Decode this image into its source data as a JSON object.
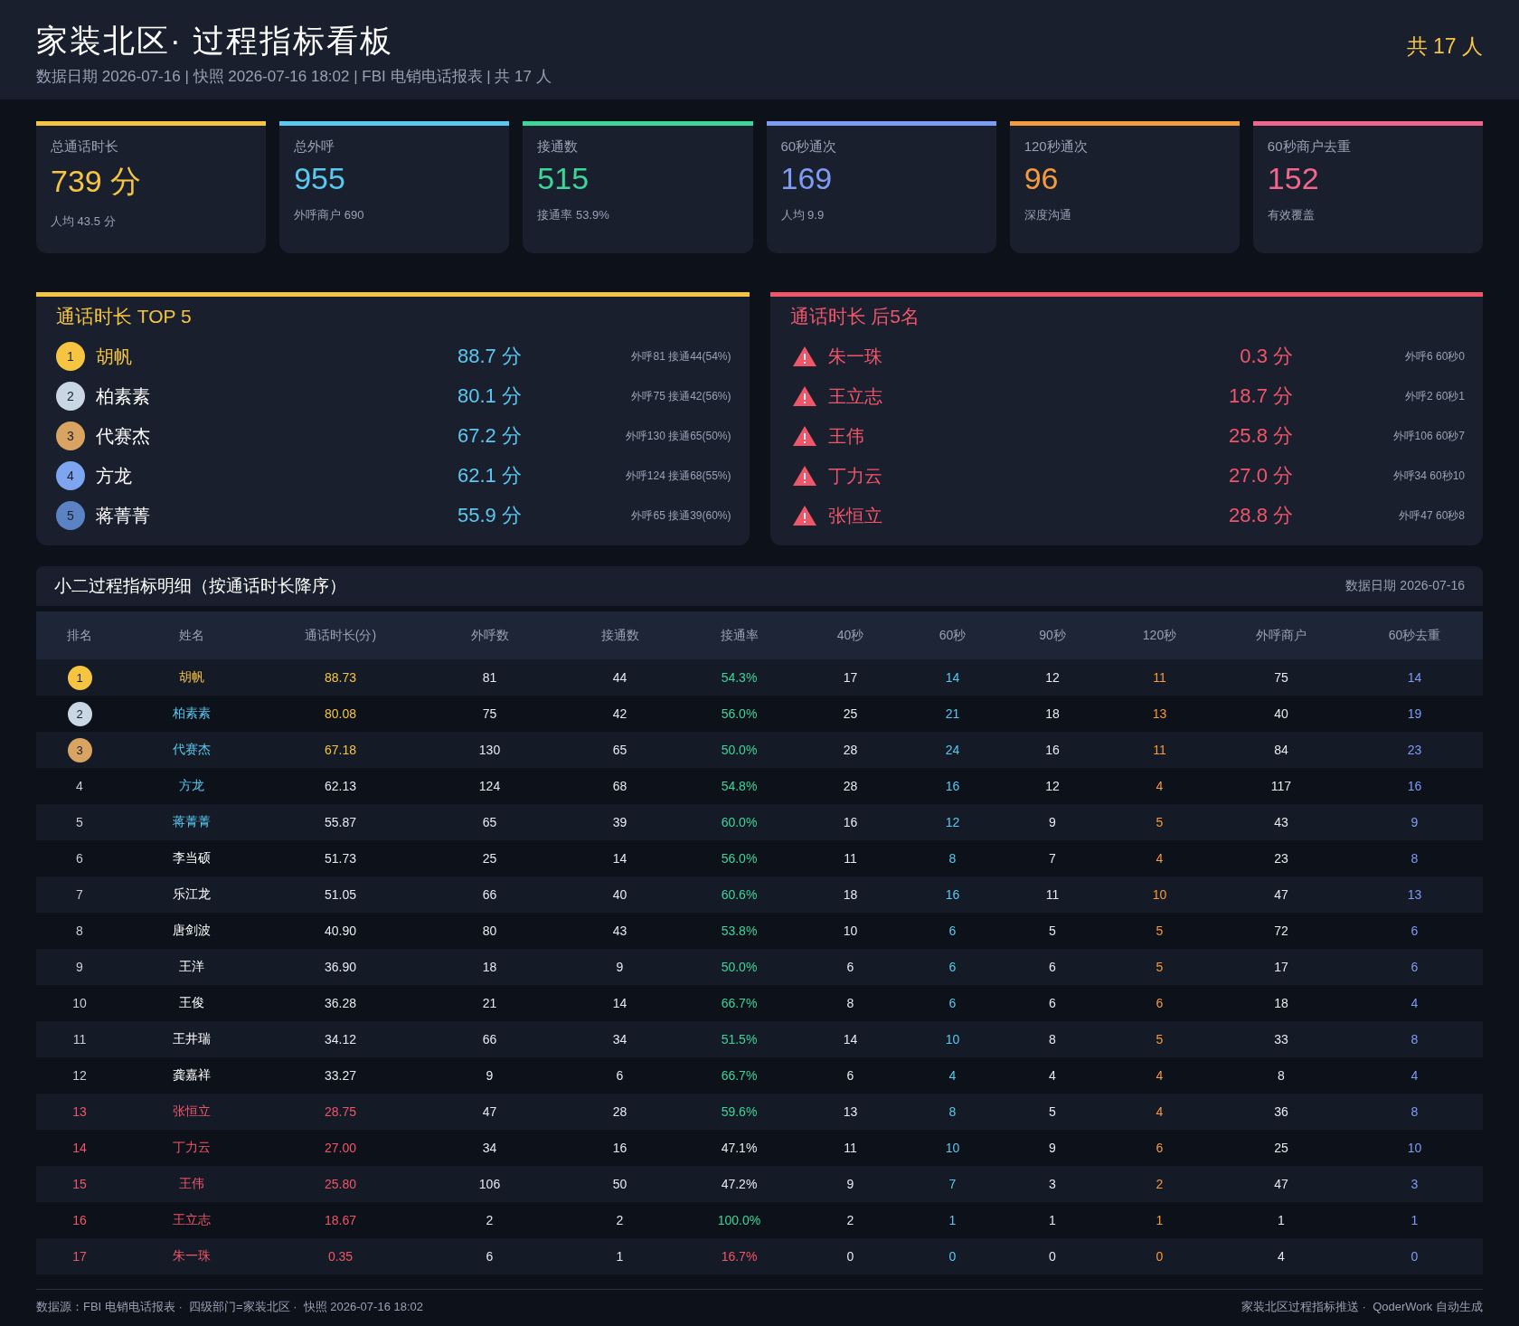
{
  "header": {
    "title": "家装北区· 过程指标看板",
    "subtitle": "数据日期 2026-07-16 | 快照 2026-07-16 18:02 | FBI 电销电话报表 | 共 17 人",
    "headcount": "共 17 人"
  },
  "kpis": [
    {
      "label": "总通话时长",
      "value": "739 分",
      "note": "人均 43.5 分",
      "color": "#f5c542"
    },
    {
      "label": "总外呼",
      "value": "955",
      "note": "外呼商户 690",
      "color": "#5bc8f0"
    },
    {
      "label": "接通数",
      "value": "515",
      "note": "接通率 53.9%",
      "color": "#3ed598"
    },
    {
      "label": "60秒通次",
      "value": "169",
      "note": "人均 9.9",
      "color": "#7f9cf5"
    },
    {
      "label": "120秒通次",
      "value": "96",
      "note": "深度沟通",
      "color": "#f59a3e"
    },
    {
      "label": "60秒商户去重",
      "value": "152",
      "note": "有效覆盖",
      "color": "#f0668c"
    }
  ],
  "top_panel": {
    "title": "通话时长 TOP 5",
    "items": [
      {
        "rank": "1",
        "name": "胡帆",
        "value": "88.7 分",
        "detail": "外呼81 接通44(54%)",
        "color": "#f5c542",
        "highlight": true
      },
      {
        "rank": "2",
        "name": "柏素素",
        "value": "80.1 分",
        "detail": "外呼75 接通42(56%)",
        "color": "#c9d6e3",
        "highlight": false
      },
      {
        "rank": "3",
        "name": "代赛杰",
        "value": "67.2 分",
        "detail": "外呼130 接通65(50%)",
        "color": "#d9a362",
        "highlight": false
      },
      {
        "rank": "4",
        "name": "方龙",
        "value": "62.1 分",
        "detail": "外呼124 接通68(55%)",
        "color": "#7ea6f0",
        "highlight": false
      },
      {
        "rank": "5",
        "name": "蒋菁菁",
        "value": "55.9 分",
        "detail": "外呼65 接通39(60%)",
        "color": "#5b83c4",
        "highlight": false
      }
    ]
  },
  "bottom_panel": {
    "title": "通话时长 后5名",
    "items": [
      {
        "name": "朱一珠",
        "value": "0.3 分",
        "detail": "外呼6 60秒0"
      },
      {
        "name": "王立志",
        "value": "18.7 分",
        "detail": "外呼2 60秒1"
      },
      {
        "name": "王伟",
        "value": "25.8 分",
        "detail": "外呼106 60秒7"
      },
      {
        "name": "丁力云",
        "value": "27.0 分",
        "detail": "外呼34 60秒10"
      },
      {
        "name": "张恒立",
        "value": "28.8 分",
        "detail": "外呼47 60秒8"
      }
    ]
  },
  "table": {
    "title": "小二过程指标明细（按通话时长降序）",
    "date": "数据日期 2026-07-16",
    "columns": [
      "排名",
      "姓名",
      "通话时长(分)",
      "外呼数",
      "接通数",
      "接通率",
      "40秒",
      "60秒",
      "90秒",
      "120秒",
      "外呼商户",
      "60秒去重"
    ],
    "rows": [
      {
        "kind": "leader",
        "color": "#f5c542",
        "cells": [
          "1",
          "胡帆",
          "88.73",
          "81",
          "44",
          "54.3%",
          "17",
          "14",
          "12",
          "11",
          "75",
          "14"
        ],
        "rate_ok": true,
        "rate_alert": false
      },
      {
        "kind": "top",
        "color": "#c9d6e3",
        "cells": [
          "2",
          "柏素素",
          "80.08",
          "75",
          "42",
          "56.0%",
          "25",
          "21",
          "18",
          "13",
          "40",
          "19"
        ],
        "rate_ok": true,
        "rate_alert": false
      },
      {
        "kind": "top",
        "color": "#d9a362",
        "cells": [
          "3",
          "代赛杰",
          "67.18",
          "130",
          "65",
          "50.0%",
          "28",
          "24",
          "16",
          "11",
          "84",
          "23"
        ],
        "rate_ok": true,
        "rate_alert": false
      },
      {
        "kind": "top",
        "cells": [
          "4",
          "方龙",
          "62.13",
          "124",
          "68",
          "54.8%",
          "28",
          "16",
          "12",
          "4",
          "117",
          "16"
        ],
        "rate_ok": true,
        "rate_alert": false
      },
      {
        "kind": "top",
        "cells": [
          "5",
          "蒋菁菁",
          "55.87",
          "65",
          "39",
          "60.0%",
          "16",
          "12",
          "9",
          "5",
          "43",
          "9"
        ],
        "rate_ok": true,
        "rate_alert": false
      },
      {
        "kind": "normal",
        "cells": [
          "6",
          "李当硕",
          "51.73",
          "25",
          "14",
          "56.0%",
          "11",
          "8",
          "7",
          "4",
          "23",
          "8"
        ],
        "rate_ok": true,
        "rate_alert": false
      },
      {
        "kind": "normal",
        "cells": [
          "7",
          "乐江龙",
          "51.05",
          "66",
          "40",
          "60.6%",
          "18",
          "16",
          "11",
          "10",
          "47",
          "13"
        ],
        "rate_ok": true,
        "rate_alert": false
      },
      {
        "kind": "normal",
        "cells": [
          "8",
          "唐剑波",
          "40.90",
          "80",
          "43",
          "53.8%",
          "10",
          "6",
          "5",
          "5",
          "72",
          "6"
        ],
        "rate_ok": true,
        "rate_alert": false
      },
      {
        "kind": "normal",
        "cells": [
          "9",
          "王洋",
          "36.90",
          "18",
          "9",
          "50.0%",
          "6",
          "6",
          "6",
          "5",
          "17",
          "6"
        ],
        "rate_ok": true,
        "rate_alert": false
      },
      {
        "kind": "normal",
        "cells": [
          "10",
          "王俊",
          "36.28",
          "21",
          "14",
          "66.7%",
          "8",
          "6",
          "6",
          "6",
          "18",
          "4"
        ],
        "rate_ok": true,
        "rate_alert": false
      },
      {
        "kind": "normal",
        "cells": [
          "11",
          "王井瑞",
          "34.12",
          "66",
          "34",
          "51.5%",
          "14",
          "10",
          "8",
          "5",
          "33",
          "8"
        ],
        "rate_ok": true,
        "rate_alert": false
      },
      {
        "kind": "normal",
        "cells": [
          "12",
          "龚嘉祥",
          "33.27",
          "9",
          "6",
          "66.7%",
          "6",
          "4",
          "4",
          "4",
          "8",
          "4"
        ],
        "rate_ok": true,
        "rate_alert": false
      },
      {
        "kind": "bottom",
        "cells": [
          "13",
          "张恒立",
          "28.75",
          "47",
          "28",
          "59.6%",
          "13",
          "8",
          "5",
          "4",
          "36",
          "8"
        ],
        "rate_ok": true,
        "rate_alert": false
      },
      {
        "kind": "bottom",
        "cells": [
          "14",
          "丁力云",
          "27.00",
          "34",
          "16",
          "47.1%",
          "11",
          "10",
          "9",
          "6",
          "25",
          "10"
        ],
        "rate_ok": false,
        "rate_alert": false
      },
      {
        "kind": "bottom",
        "cells": [
          "15",
          "王伟",
          "25.80",
          "106",
          "50",
          "47.2%",
          "9",
          "7",
          "3",
          "2",
          "47",
          "3"
        ],
        "rate_ok": false,
        "rate_alert": false
      },
      {
        "kind": "bottom",
        "cells": [
          "16",
          "王立志",
          "18.67",
          "2",
          "2",
          "100.0%",
          "2",
          "1",
          "1",
          "1",
          "1",
          "1"
        ],
        "rate_ok": true,
        "rate_alert": false
      },
      {
        "kind": "bottom",
        "cells": [
          "17",
          "朱一珠",
          "0.35",
          "6",
          "1",
          "16.7%",
          "0",
          "0",
          "0",
          "0",
          "4",
          "0"
        ],
        "rate_ok": false,
        "rate_alert": true
      }
    ]
  },
  "footer": {
    "left": "数据源：FBI 电销电话报表 ·  四级部门=家装北区 ·  快照 2026-07-16 18:02",
    "right": "家装北区过程指标推送 ·  QoderWork 自动生成"
  }
}
